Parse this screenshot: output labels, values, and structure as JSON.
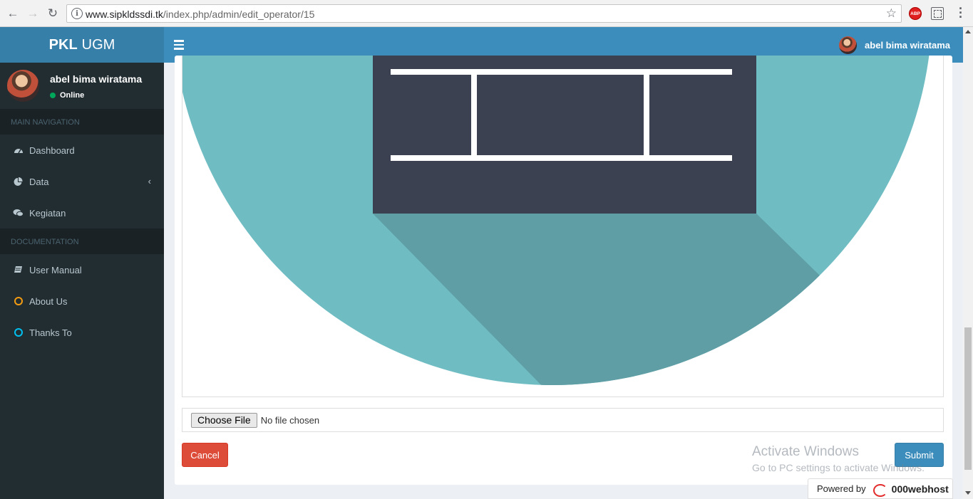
{
  "browser": {
    "url_host": "www.sipkldssdi.tk",
    "url_path": "/index.php/admin/edit_operator/15",
    "extension_abp": "ABP"
  },
  "logo": {
    "bold": "PKL",
    "light": "UGM"
  },
  "header": {
    "user_name": "abel bima wiratama"
  },
  "sidebar": {
    "user_name": "abel bima wiratama",
    "status": "Online",
    "sections": [
      {
        "label": "MAIN NAVIGATION"
      },
      {
        "label": "DOCUMENTATION"
      }
    ],
    "items": [
      {
        "label": "Dashboard",
        "icon": "dashboard-icon"
      },
      {
        "label": "Data",
        "icon": "pie-chart-icon"
      },
      {
        "label": "Kegiatan",
        "icon": "comments-icon"
      },
      {
        "label": "User Manual",
        "icon": "book-icon"
      },
      {
        "label": "About Us",
        "icon": "circle-outline-icon",
        "color": "#f39c12"
      },
      {
        "label": "Thanks To",
        "icon": "circle-outline-icon",
        "color": "#00c0ef"
      }
    ]
  },
  "form": {
    "choose_file_label": "Choose File",
    "file_status": "No file chosen",
    "cancel_label": "Cancel",
    "submit_label": "Submit"
  },
  "watermark": {
    "title": "Activate Windows",
    "subtitle": "Go to PC settings to activate Windows."
  },
  "powered": {
    "prefix": "Powered by",
    "brand": "000webhost"
  },
  "colors": {
    "header_blue": "#3c8dbc",
    "logo_blue": "#367fa9",
    "sidebar_dark": "#222d32",
    "cancel_red": "#dd4b39",
    "circle_teal": "#6fbdc3",
    "shadow_teal": "#5e9ea4",
    "board_dark": "#3c4151"
  }
}
